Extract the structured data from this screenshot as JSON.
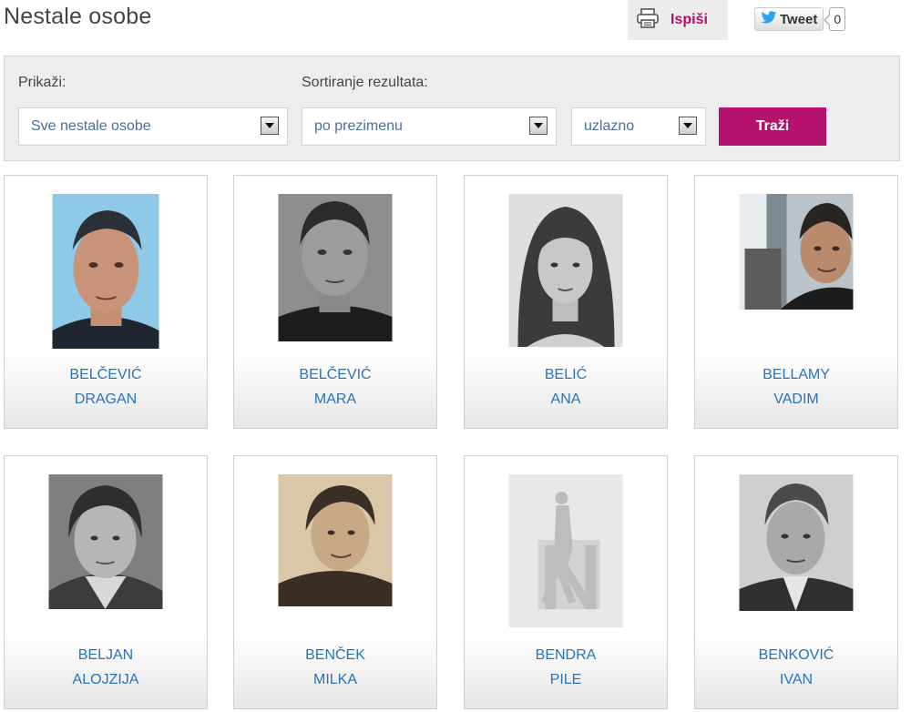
{
  "page_title": "Nestale osobe",
  "toolbar": {
    "print_label": "Ispiši",
    "tweet_label": "Tweet",
    "tweet_count": "0",
    "accent_color": "#b5126e"
  },
  "filter": {
    "show_label": "Prikaži:",
    "show_value": "Sve nestale osobe",
    "sort_label": "Sortiranje rezultata:",
    "sort_value": "po prezimenu",
    "order_value": "uzlazno",
    "search_label": "Traži"
  },
  "people": [
    {
      "surname": "BELČEVIĆ",
      "firstname": "DRAGAN"
    },
    {
      "surname": "BELČEVIĆ",
      "firstname": "MARA"
    },
    {
      "surname": "BELIĆ",
      "firstname": "ANA"
    },
    {
      "surname": "BELLAMY",
      "firstname": "VADIM"
    },
    {
      "surname": "BELJAN",
      "firstname": "ALOJZIJA"
    },
    {
      "surname": "BENČEK",
      "firstname": "MILKA"
    },
    {
      "surname": "BENDRA",
      "firstname": "PILE"
    },
    {
      "surname": "BENKOVIĆ",
      "firstname": "IVAN"
    }
  ]
}
